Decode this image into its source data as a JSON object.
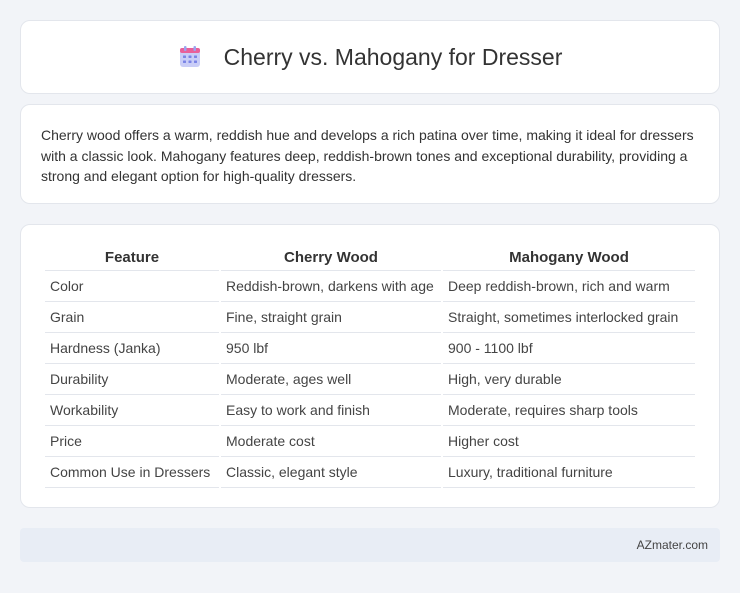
{
  "header": {
    "title": "Cherry vs. Mahogany for Dresser",
    "icon": "calendar-icon"
  },
  "intro": {
    "text": "Cherry wood offers a warm, reddish hue and develops a rich patina over time, making it ideal for dressers with a classic look. Mahogany features deep, reddish-brown tones and exceptional durability, providing a strong and elegant option for high-quality dressers."
  },
  "table": {
    "headers": [
      "Feature",
      "Cherry Wood",
      "Mahogany Wood"
    ],
    "rows": [
      [
        "Color",
        "Reddish-brown, darkens with age",
        "Deep reddish-brown, rich and warm"
      ],
      [
        "Grain",
        "Fine, straight grain",
        "Straight, sometimes interlocked grain"
      ],
      [
        "Hardness (Janka)",
        "950 lbf",
        "900 - 1100 lbf"
      ],
      [
        "Durability",
        "Moderate, ages well",
        "High, very durable"
      ],
      [
        "Workability",
        "Easy to work and finish",
        "Moderate, requires sharp tools"
      ],
      [
        "Price",
        "Moderate cost",
        "Higher cost"
      ],
      [
        "Common Use in Dressers",
        "Classic, elegant style",
        "Luxury, traditional furniture"
      ]
    ]
  },
  "footer": {
    "brand": "AZmater.com"
  },
  "colors": {
    "icon_top": "#e8609a",
    "icon_body": "#9aa4f0",
    "page_bg": "#f2f4f8",
    "footer_bg": "#e8edf5"
  }
}
